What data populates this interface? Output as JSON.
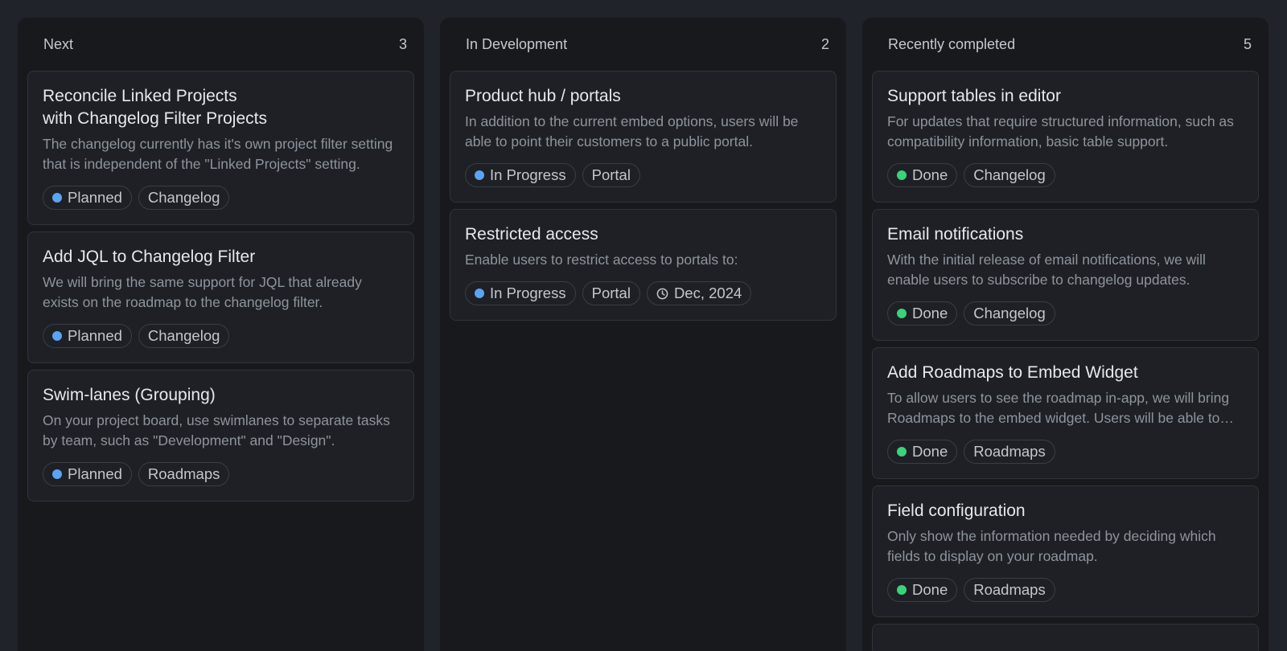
{
  "colors": {
    "planned": "#5aa4f4",
    "in_progress": "#5aa4f4",
    "done": "#3ad27a"
  },
  "columns": [
    {
      "title": "Next",
      "count": "3",
      "cards": [
        {
          "title": "Reconcile Linked Projects\nwith Changelog Filter Projects",
          "description": "The changelog currently has it's own project filter setting that is independent of the \"Linked Projects\" setting.",
          "status": "Planned",
          "tags": [
            "Changelog"
          ]
        },
        {
          "title": "Add JQL to Changelog Filter",
          "description": "We will bring the same support for JQL that already exists on the roadmap to the changelog filter.",
          "status": "Planned",
          "tags": [
            "Changelog"
          ]
        },
        {
          "title": "Swim-lanes (Grouping)",
          "description": "On your project board, use swimlanes to separate tasks by team, such as \"Development\" and \"Design\".",
          "status": "Planned",
          "tags": [
            "Roadmaps"
          ]
        }
      ]
    },
    {
      "title": "In Development",
      "count": "2",
      "cards": [
        {
          "title": "Product hub / portals",
          "description": "In addition to the current embed options, users will be able to point their customers to a public portal.",
          "status": "In Progress",
          "tags": [
            "Portal"
          ]
        },
        {
          "title": "Restricted access",
          "description": "Enable users to restrict access to portals to:",
          "status": "In Progress",
          "tags": [
            "Portal"
          ],
          "date": "Dec, 2024",
          "date_icon": "clock-icon"
        }
      ]
    },
    {
      "title": "Recently completed",
      "count": "5",
      "cards": [
        {
          "title": "Support tables in editor",
          "description": "For updates that require structured information, such as compatibility information, basic table support.",
          "status": "Done",
          "tags": [
            "Changelog"
          ]
        },
        {
          "title": "Email notifications",
          "description": "With the initial release of email notifications, we will enable users to subscribe to changelog updates.",
          "status": "Done",
          "tags": [
            "Changelog"
          ]
        },
        {
          "title": "Add Roadmaps to Embed Widget",
          "description": "To allow users to see the roadmap in-app, we will bring Roadmaps to the embed widget. Users will be able to vote.",
          "status": "Done",
          "tags": [
            "Roadmaps"
          ]
        },
        {
          "title": "Field configuration",
          "description": "Only show the information needed by deciding which fields to display on your roadmap.",
          "status": "Done",
          "tags": [
            "Roadmaps"
          ]
        }
      ]
    }
  ]
}
